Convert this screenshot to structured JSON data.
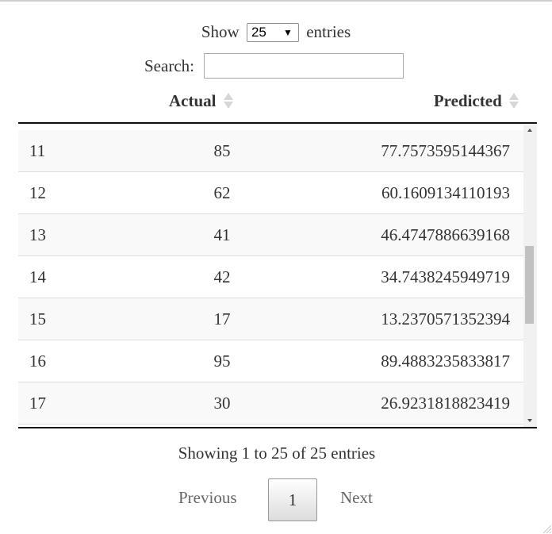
{
  "length": {
    "prefix": "Show",
    "selected": "25",
    "suffix": "entries"
  },
  "search": {
    "label": "Search:",
    "value": ""
  },
  "columns": {
    "actual": "Actual",
    "predicted": "Predicted"
  },
  "rows": [
    {
      "index": "11",
      "actual": "85",
      "predicted": "77.7573595144367"
    },
    {
      "index": "12",
      "actual": "62",
      "predicted": "60.1609134110193"
    },
    {
      "index": "13",
      "actual": "41",
      "predicted": "46.4747886639168"
    },
    {
      "index": "14",
      "actual": "42",
      "predicted": "34.7438245949719"
    },
    {
      "index": "15",
      "actual": "17",
      "predicted": "13.2370571352394"
    },
    {
      "index": "16",
      "actual": "95",
      "predicted": "89.4883235833817"
    },
    {
      "index": "17",
      "actual": "30",
      "predicted": "26.9231818823419"
    }
  ],
  "info": "Showing 1 to 25 of 25 entries",
  "pagination": {
    "previous": "Previous",
    "current_page": "1",
    "next": "Next"
  },
  "icons": {
    "sort": "sort-both-icon",
    "select_caret": "caret-down-icon",
    "scroll_up": "scroll-up-arrow-icon",
    "scroll_down": "scroll-down-arrow-icon",
    "resize": "resize-grip-icon"
  }
}
